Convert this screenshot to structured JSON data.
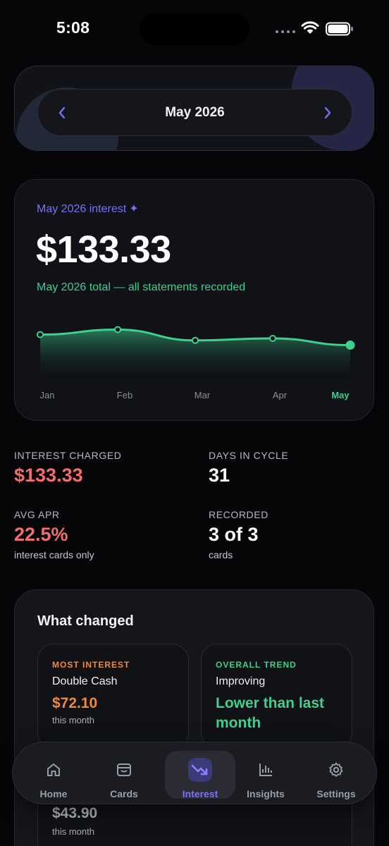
{
  "status_bar": {
    "time": "5:08"
  },
  "month_selector": {
    "label": "May 2026"
  },
  "summary": {
    "title": "May 2026 interest",
    "amount": "$133.33",
    "subtitle": "May 2026 total — all statements recorded"
  },
  "chart_data": {
    "type": "area",
    "x": [
      "Jan",
      "Feb",
      "Mar",
      "Apr",
      "May"
    ],
    "series": [
      {
        "values": [
          133.1,
          139.5,
          125.6,
          128.2,
          119.5
        ]
      }
    ],
    "highlight": "May",
    "grid": false,
    "axis_labels_visible": false
  },
  "stats": {
    "interest_charged": {
      "label": "INTEREST CHARGED",
      "value": "$133.33"
    },
    "days_in_cycle": {
      "label": "DAYS IN CYCLE",
      "value": "31"
    },
    "avg_apr": {
      "label": "AVG APR",
      "value": "22.5%",
      "note": "interest cards only"
    },
    "recorded": {
      "label": "RECORDED",
      "value": "3 of 3",
      "note": "cards"
    }
  },
  "what_changed": {
    "title": "What changed",
    "most_interest": {
      "kicker": "MOST INTEREST",
      "name": "Double Cash",
      "value": "$72.10",
      "note": "this month"
    },
    "overall_trend": {
      "kicker": "OVERALL TREND",
      "name": "Improving",
      "value": "Lower than last month"
    },
    "third": {
      "value": "$43.90",
      "note": "this month"
    }
  },
  "tabs": [
    {
      "label": "Home",
      "icon": "house-icon"
    },
    {
      "label": "Cards",
      "icon": "wallet-icon"
    },
    {
      "label": "Interest",
      "icon": "trend-down-icon",
      "active": true
    },
    {
      "label": "Insights",
      "icon": "bar-chart-icon"
    },
    {
      "label": "Settings",
      "icon": "gear-icon"
    }
  ],
  "colors": {
    "accent": "#7f6ff4",
    "positive": "#3fcf8e",
    "negative": "#f26d6d",
    "warning": "#f08a3c"
  }
}
